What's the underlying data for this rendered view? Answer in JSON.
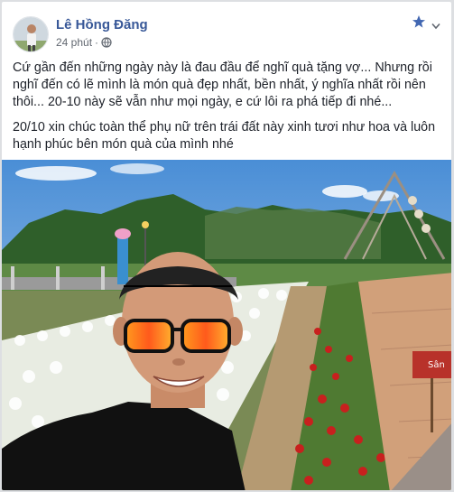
{
  "post": {
    "author_name": "Lê Hồng Đăng",
    "timestamp": "24 phút",
    "privacy_icon": "globe-icon",
    "star_icon": "star-icon",
    "menu_icon": "chevron-down-icon",
    "paragraphs": [
      "Cứ gần đến những ngày này là đau đầu để nghĩ quà tặng vợ... Nhưng rồi nghĩ đến có lẽ mình là món quà đẹp nhất, bền nhất, ý nghĩa nhất rồi nên thôi... 20-10 này sẽ vẫn như mọi ngày, e cứ lôi ra phá tiếp đi nhé...",
      "20/10 xin chúc toàn thể phụ nữ trên trái đất này xinh tươi như hoa và luôn hạnh phúc bên món quà của mình nhé"
    ],
    "sign_text": "Sân"
  },
  "colors": {
    "author_link": "#385898",
    "meta_text": "#616770",
    "body_text": "#1d2129",
    "star_blue": "#4267b2"
  }
}
